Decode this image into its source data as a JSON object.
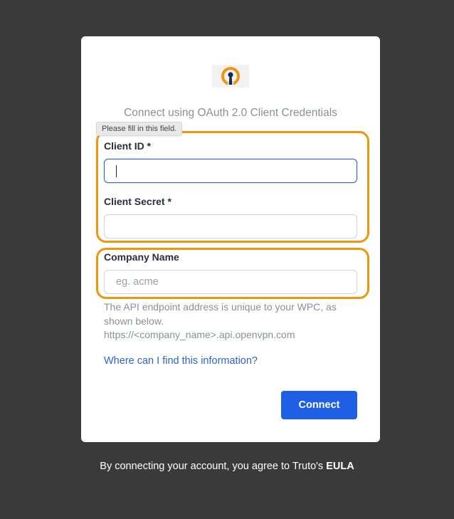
{
  "logo": {
    "icon": "openvpn-logo-icon",
    "colors": {
      "orange": "#f0960e",
      "navy": "#1a2a4f"
    }
  },
  "subtitle": "Connect using OAuth 2.0 Client Credentials",
  "tooltip": "Please fill in this field.",
  "fields": {
    "client_id": {
      "label": "Client ID *",
      "value": "",
      "placeholder": ""
    },
    "client_secret": {
      "label": "Client Secret *",
      "value": "",
      "placeholder": ""
    },
    "company_name": {
      "label": "Company Name",
      "value": "",
      "placeholder": "eg. acme"
    }
  },
  "help": {
    "line1": "The API endpoint address is unique to your WPC, as shown below.",
    "line2": "https://<company_name>.api.openvpn.com"
  },
  "link_text": "Where can I find this information?",
  "connect_label": "Connect",
  "footer": {
    "prefix": "By connecting your account, you agree to Truto's ",
    "eula": "EULA"
  },
  "colors": {
    "accent": "#1f5fe6",
    "highlight": "#f0960e",
    "background": "#3a3a3a"
  }
}
